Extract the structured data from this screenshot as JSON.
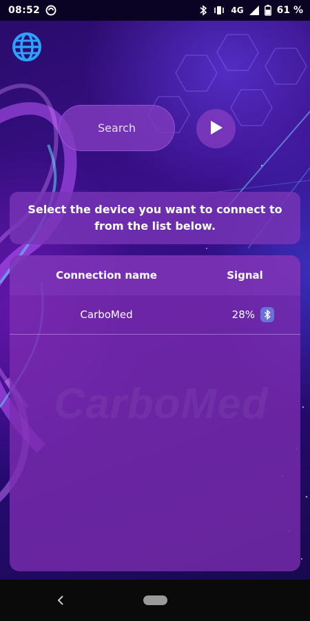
{
  "status_bar": {
    "time": "08:52",
    "network": "4G",
    "battery": "61 %",
    "icons": [
      "sync-icon",
      "bluetooth-icon",
      "vibrate-icon",
      "signal-icon",
      "battery-icon"
    ]
  },
  "toolbar": {
    "language_icon": "globe-icon"
  },
  "search": {
    "label": "Search",
    "start_icon": "play-icon"
  },
  "instruction": {
    "text": "Select the device you want to connect to from the list below."
  },
  "device_table": {
    "columns": [
      "Connection name",
      "Signal"
    ],
    "rows": [
      {
        "name": "CarboMed",
        "signal": "28%",
        "icon": "bluetooth-icon"
      }
    ],
    "watermark": "CarboMed"
  },
  "colors": {
    "panel": "#7a2caf",
    "accent_blue": "#2aa3ff",
    "bluetooth_badge": "#6a72d8"
  }
}
